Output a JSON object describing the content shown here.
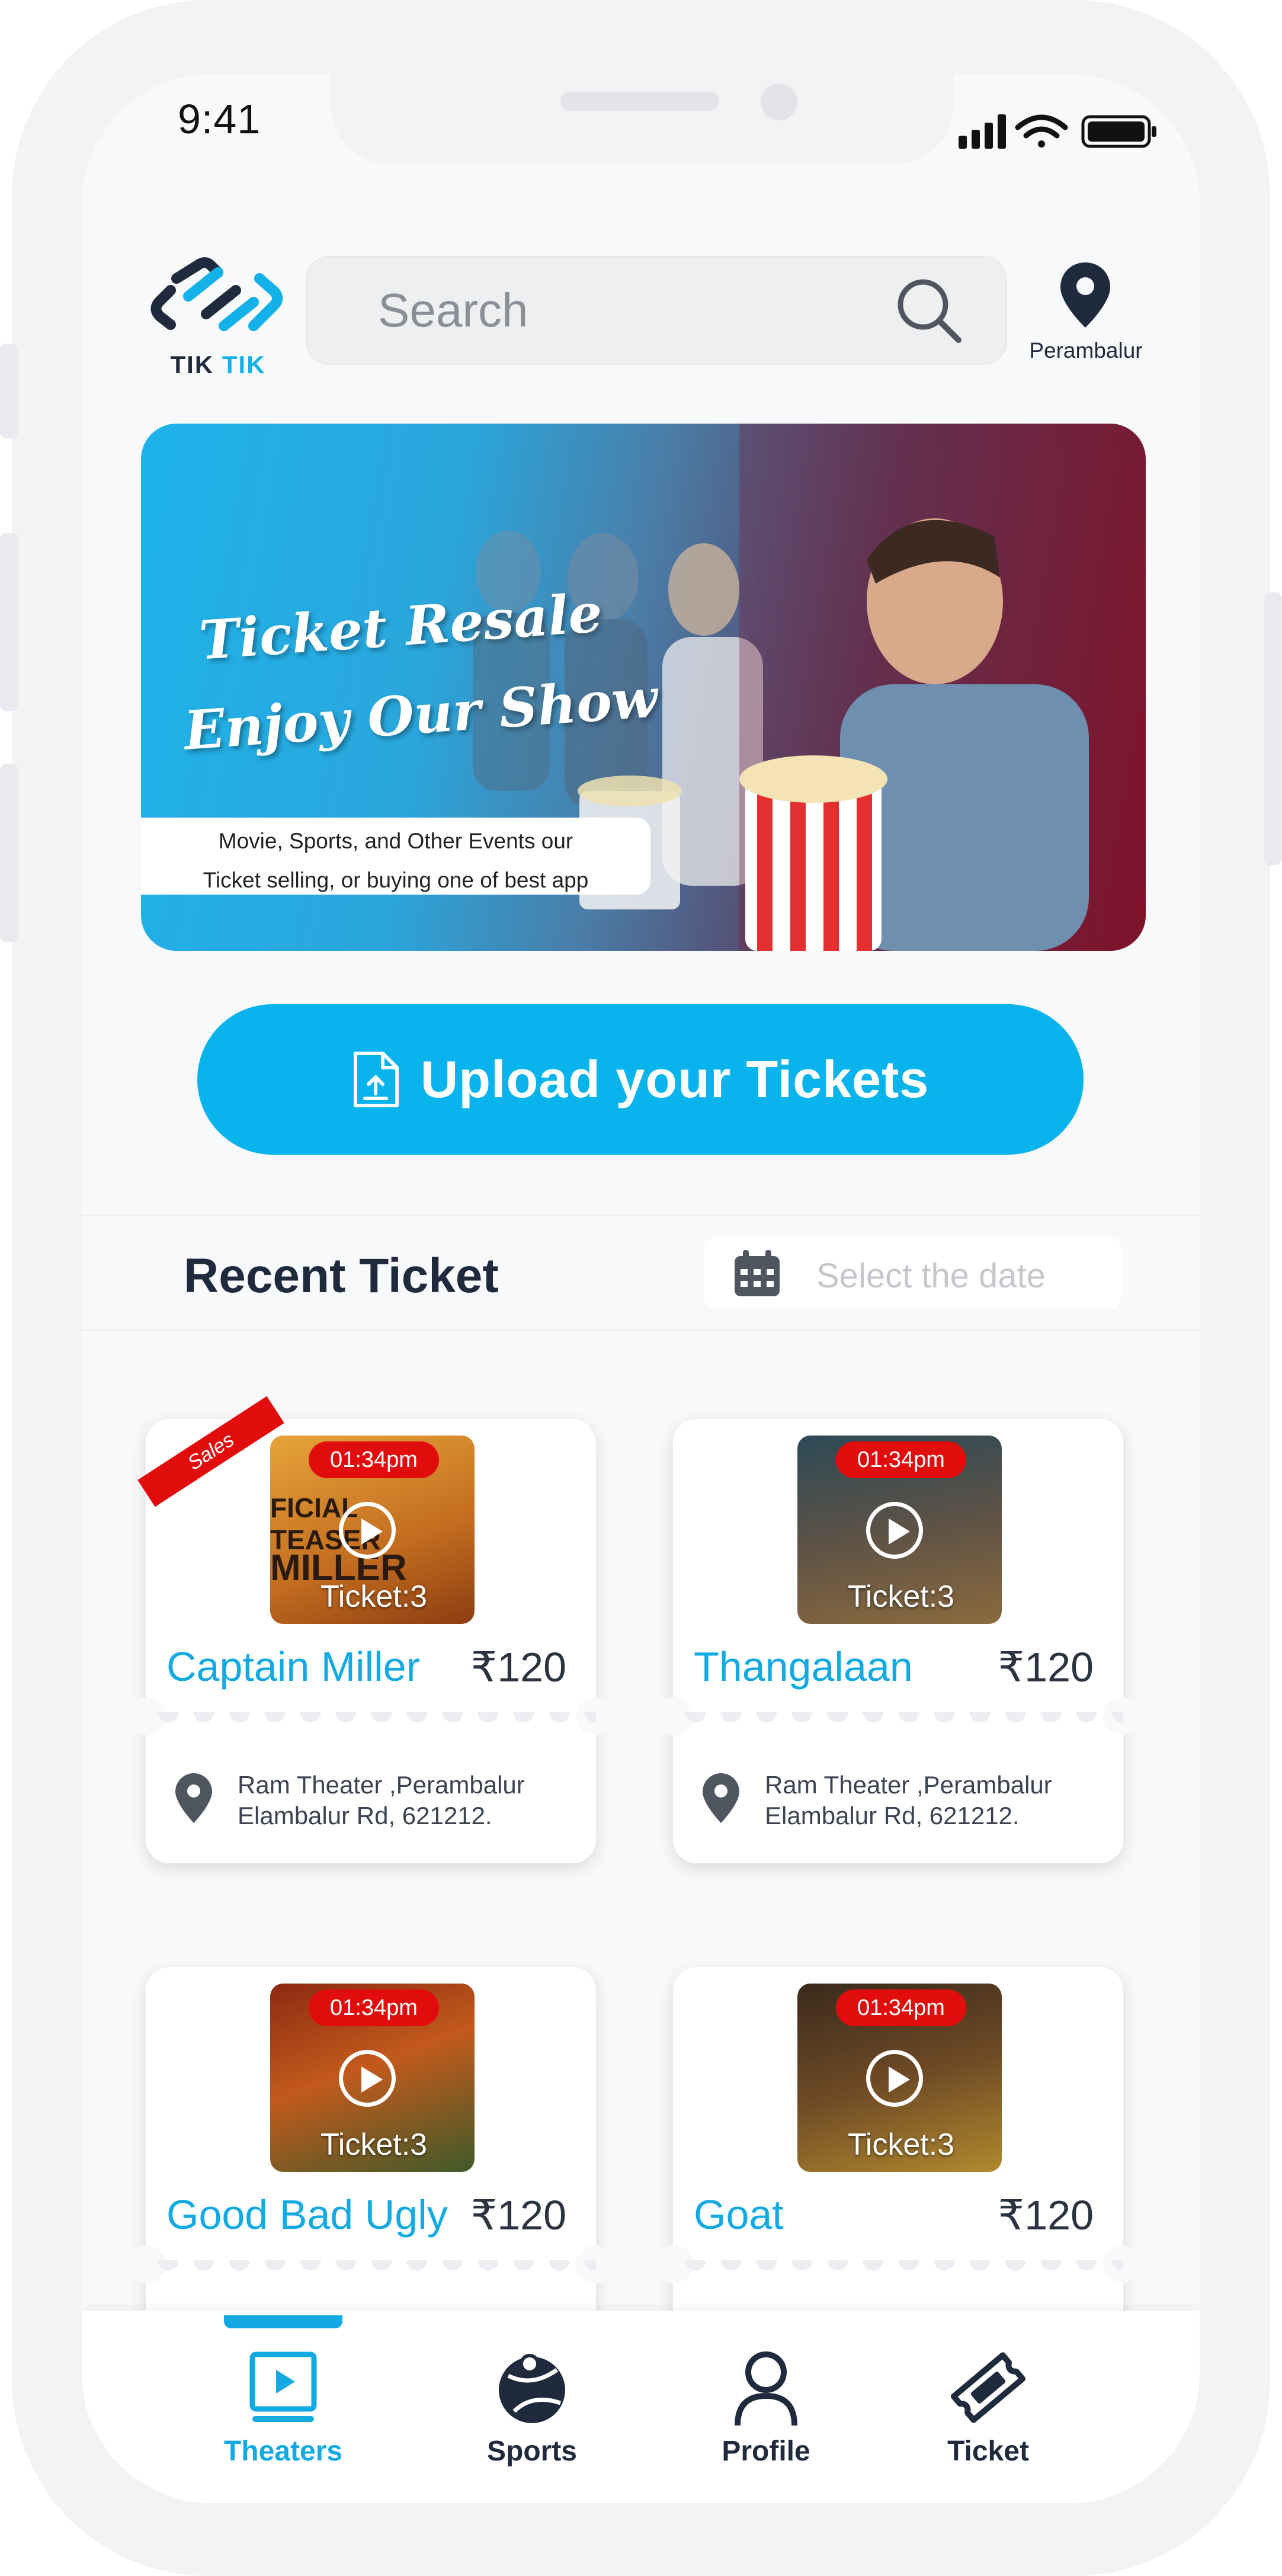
{
  "status_bar": {
    "time": "9:41"
  },
  "header": {
    "logo_text_dark": "TIK",
    "logo_text_accent": "TIK",
    "search_placeholder": "Search",
    "location": "Perambalur"
  },
  "banner": {
    "headline_line1": "Ticket Resale",
    "headline_line2": "Enjoy Our Show",
    "caption_line1": "Movie, Sports, and Other Events our",
    "caption_line2": "Ticket selling, or buying one of best app"
  },
  "upload_button": {
    "label": "Upload your Tickets"
  },
  "recent": {
    "title": "Recent Ticket",
    "date_placeholder": "Select the date"
  },
  "tickets": [
    {
      "title": "Captain Miller",
      "price": "₹120",
      "time": "01:34pm",
      "count": "Ticket:3",
      "address_line1": "Ram Theater ,Perambalur",
      "address_line2": "Elambalur Rd,  621212.",
      "badge": "Sales",
      "poster_text": "FICIAL TEASER",
      "poster_text2": "MILLER"
    },
    {
      "title": "Thangalaan",
      "price": "₹120",
      "time": "01:34pm",
      "count": "Ticket:3",
      "address_line1": "Ram Theater ,Perambalur",
      "address_line2": "Elambalur Rd,  621212."
    },
    {
      "title": "Good Bad Ugly",
      "price": "₹120",
      "time": "01:34pm",
      "count": "Ticket:3"
    },
    {
      "title": "Goat",
      "price": "₹120",
      "time": "01:34pm",
      "count": "Ticket:3"
    }
  ],
  "nav": {
    "items": [
      {
        "label": "Theaters",
        "icon": "play-screen-icon",
        "active": true
      },
      {
        "label": "Sports",
        "icon": "sports-icon",
        "active": false
      },
      {
        "label": "Profile",
        "icon": "profile-icon",
        "active": false
      },
      {
        "label": "Ticket",
        "icon": "ticket-icon",
        "active": false
      }
    ]
  },
  "colors": {
    "accent": "#13a9e3",
    "button": "#09b3ec",
    "badge": "#e10d0d",
    "text_dark": "#1f2a3c"
  }
}
